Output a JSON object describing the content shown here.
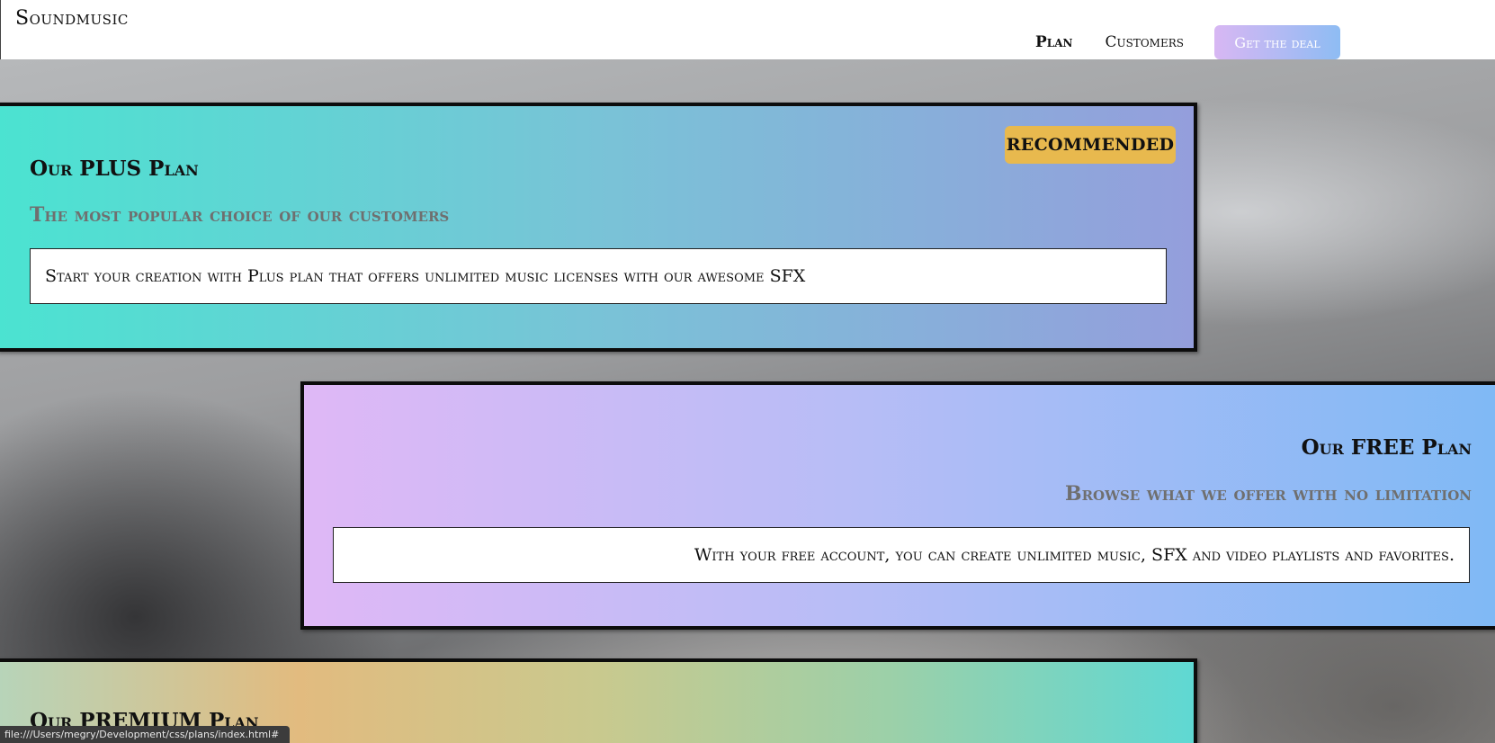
{
  "brand": "Soundmusic",
  "nav": {
    "items": [
      "Plan",
      "Customers"
    ],
    "cta": "Get the deal"
  },
  "plans": {
    "plus": {
      "badge": "RECOMMENDED",
      "title": "Our PLUS Plan",
      "subtitle": "The most popular choice of our customers",
      "description": "Start your creation with Plus plan that offers unlimited music licenses with our awesome SFX"
    },
    "free": {
      "title": "Our FREE Plan",
      "subtitle": "Browse what we offer with no limitation",
      "description": "With your free account, you can create unlimited music, SFX and video playlists and favorites."
    },
    "premium": {
      "title": "Our PREMIUM Plan"
    }
  },
  "status_bar": "file:///Users/megry/Development/css/plans/index.html#",
  "colors": {
    "cta_gradient_start": "#d8b7f3",
    "cta_gradient_end": "#8ebcf3",
    "badge": "#e8b94e",
    "plus_gradient_start": "#4be3d1",
    "plus_gradient_end": "#949edc",
    "free_gradient_start": "#dfb8f6",
    "free_gradient_end": "#7fb9f5"
  }
}
